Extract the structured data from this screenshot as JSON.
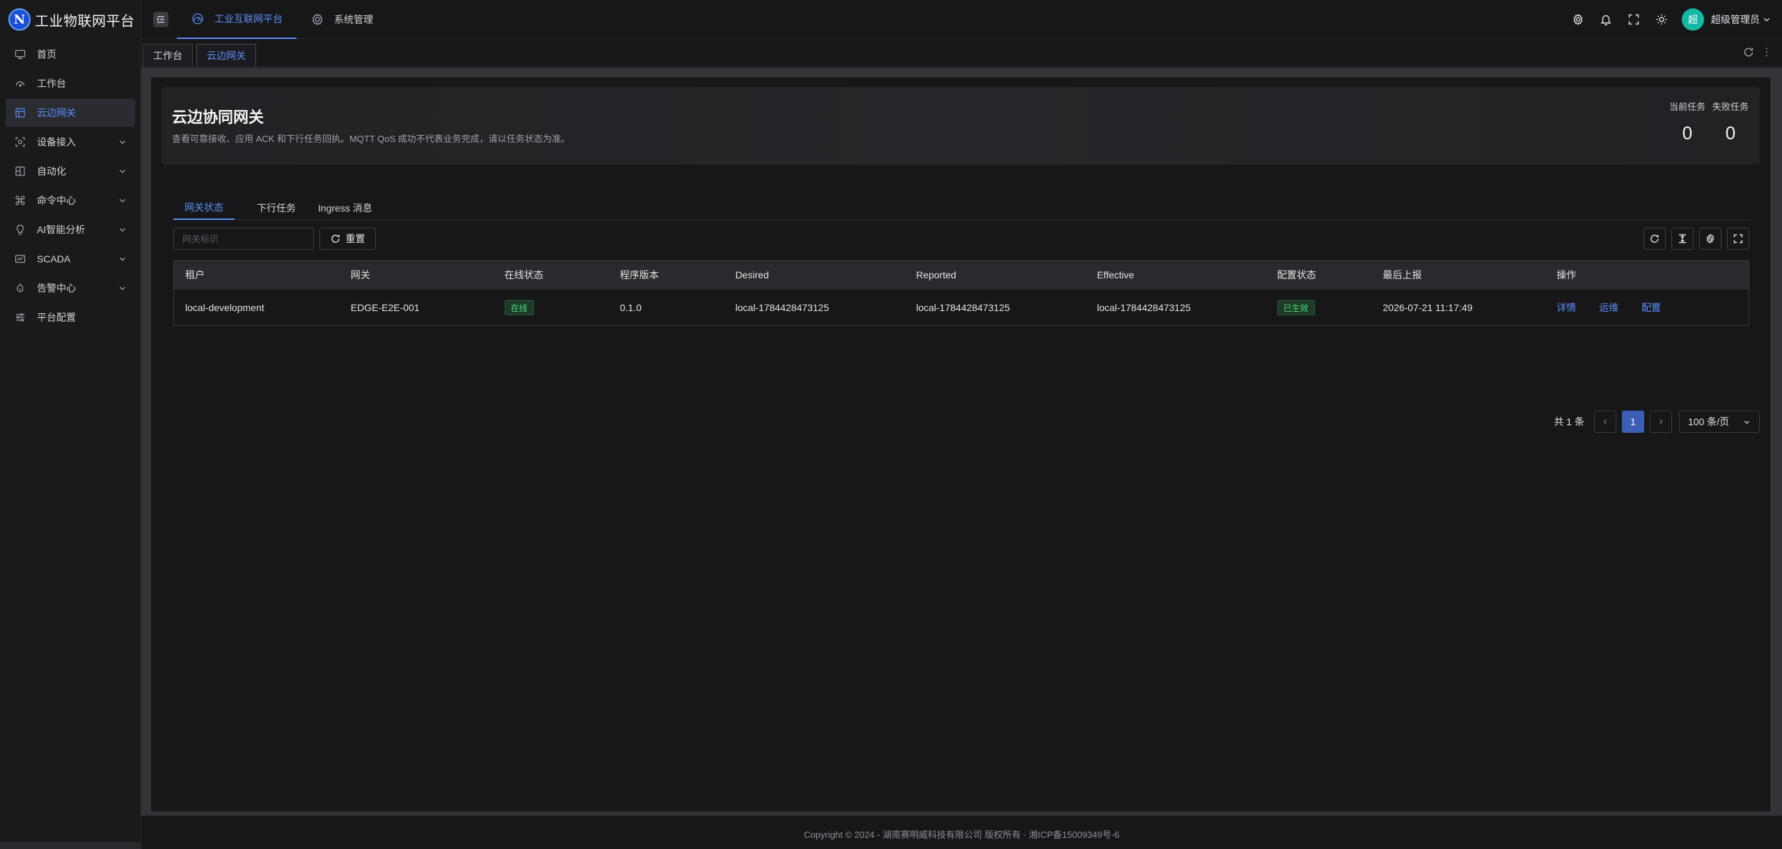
{
  "app": {
    "logo_letter": "N",
    "title": "工业物联网平台"
  },
  "sidebar": {
    "items": [
      {
        "label": "首页",
        "icon": "monitor-icon"
      },
      {
        "label": "工作台",
        "icon": "dashboard-gauge-icon"
      },
      {
        "label": "云边网关",
        "icon": "layout-grid-icon",
        "active": true
      },
      {
        "label": "设备接入",
        "icon": "device-scan-icon",
        "expandable": true
      },
      {
        "label": "自动化",
        "icon": "layout-panel-icon",
        "expandable": true
      },
      {
        "label": "命令中心",
        "icon": "command-icon",
        "expandable": true
      },
      {
        "label": "AI智能分析",
        "icon": "lightbulb-icon",
        "expandable": true
      },
      {
        "label": "SCADA",
        "icon": "scada-screen-icon",
        "expandable": true
      },
      {
        "label": "告警中心",
        "icon": "alarm-icon",
        "expandable": true
      },
      {
        "label": "平台配置",
        "icon": "sliders-icon"
      }
    ]
  },
  "header": {
    "tabs": [
      {
        "label": "工业互联网平台",
        "icon": "platform-icon",
        "active": true
      },
      {
        "label": "系统管理",
        "icon": "gear-icon"
      }
    ],
    "avatar_text": "超",
    "user_name": "超级管理员"
  },
  "page_tabs": [
    {
      "label": "工作台"
    },
    {
      "label": "云边网关",
      "active": true
    }
  ],
  "hero": {
    "title": "云边协同网关",
    "description": "查看可靠接收、应用 ACK 和下行任务回执。MQTT QoS 成功不代表业务完成，请以任务状态为准。",
    "kpis": [
      {
        "label": "当前任务",
        "value": "0"
      },
      {
        "label": "失败任务",
        "value": "0"
      }
    ]
  },
  "content_tabs": [
    {
      "label": "网关状态",
      "active": true
    },
    {
      "label": "下行任务"
    },
    {
      "label": "Ingress 消息"
    }
  ],
  "toolbar": {
    "search_placeholder": "网关标识",
    "search_value": "",
    "reset_label": "重置"
  },
  "table": {
    "columns": [
      "租户",
      "网关",
      "在线状态",
      "程序版本",
      "Desired",
      "Reported",
      "Effective",
      "配置状态",
      "最后上报",
      "操作"
    ],
    "rows": [
      {
        "tenant": "local-development",
        "gateway": "EDGE-E2E-001",
        "online_status": "在线",
        "version": "0.1.0",
        "desired": "local-1784428473125",
        "reported": "local-1784428473125",
        "effective": "local-1784428473125",
        "config_status": "已生效",
        "last_report": "2026-07-21 11:17:49",
        "actions": [
          "详情",
          "运维",
          "配置"
        ]
      }
    ]
  },
  "pagination": {
    "total_text": "共 1 条",
    "current_page": "1",
    "page_size": "100 条/页"
  },
  "footer": {
    "copyright": "Copyright © 2024 - 湖南赛明威科技有限公司 版权所有 · 湘ICP备15009349号-6"
  },
  "colors": {
    "accent": "#5b8ff9",
    "success": "#4ade80",
    "avatar_bg": "#14b8a6",
    "page_active": "#3b5fb4"
  }
}
